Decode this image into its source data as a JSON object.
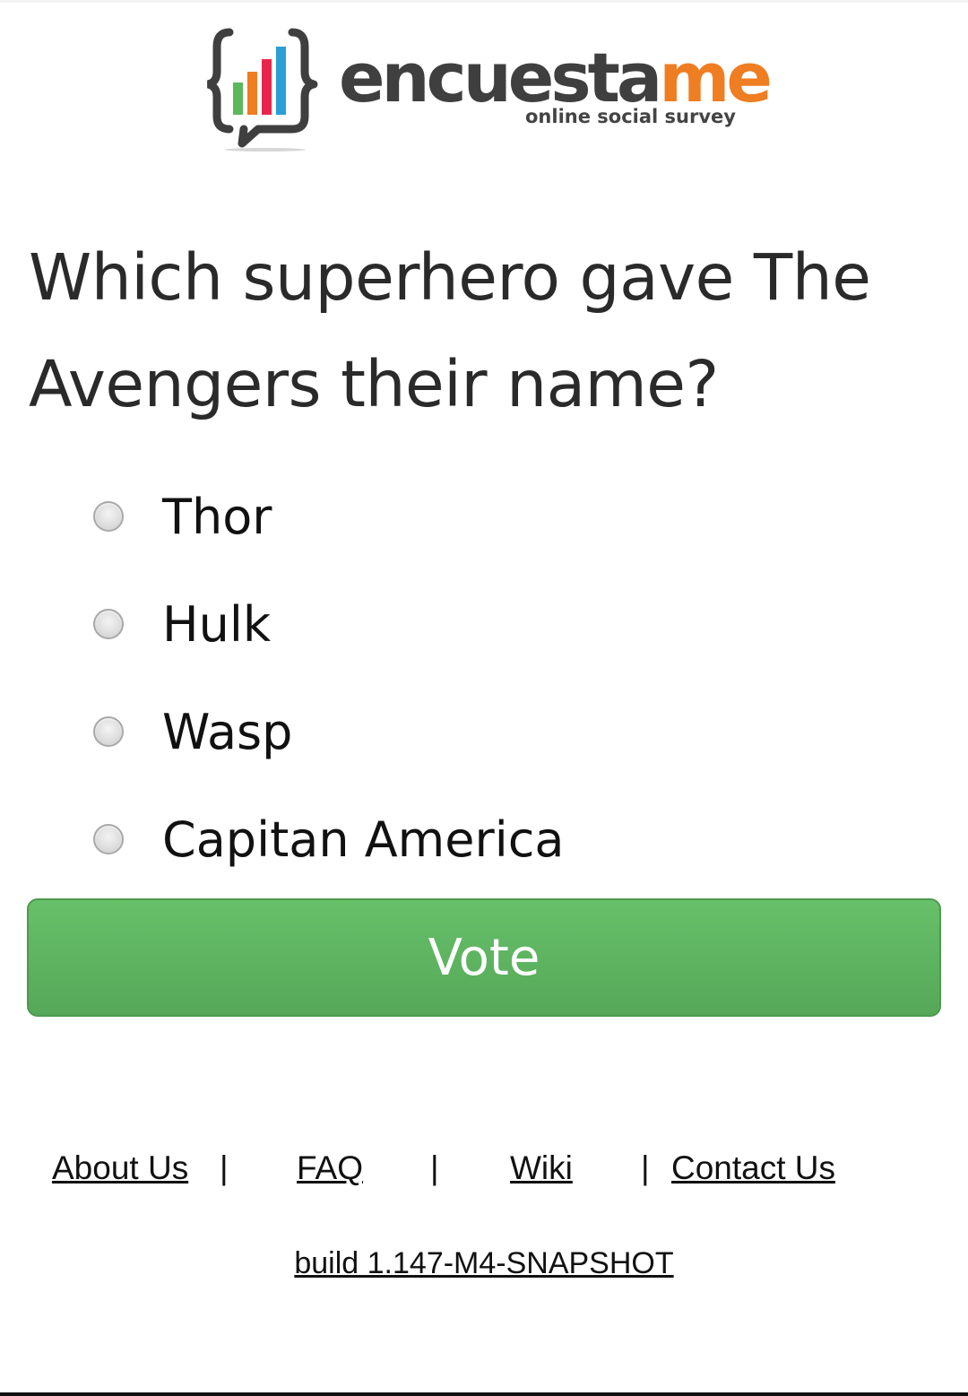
{
  "logo": {
    "word_dark": "encuesta",
    "word_accent": "me",
    "tagline": "online social survey",
    "icon": "bar-chart-braces-icon",
    "colors": {
      "dark": "#3f3f3f",
      "accent": "#ef7d22",
      "bar_green": "#5cb85c",
      "bar_orange": "#ef7d22",
      "bar_red": "#e8264b",
      "bar_blue": "#2a9fd6"
    }
  },
  "question": {
    "text": "Which superhero gave The Avengers their name?"
  },
  "options": [
    {
      "label": "Thor",
      "selected": false
    },
    {
      "label": "Hulk",
      "selected": false
    },
    {
      "label": "Wasp",
      "selected": false
    },
    {
      "label": "Capitan America",
      "selected": false
    }
  ],
  "vote_button": {
    "label": "Vote",
    "color": "#5cb85c"
  },
  "footer": {
    "links": [
      "About Us",
      "FAQ",
      "Wiki",
      "Contact Us"
    ],
    "separator": "|",
    "build": "build 1.147-M4-SNAPSHOT"
  }
}
